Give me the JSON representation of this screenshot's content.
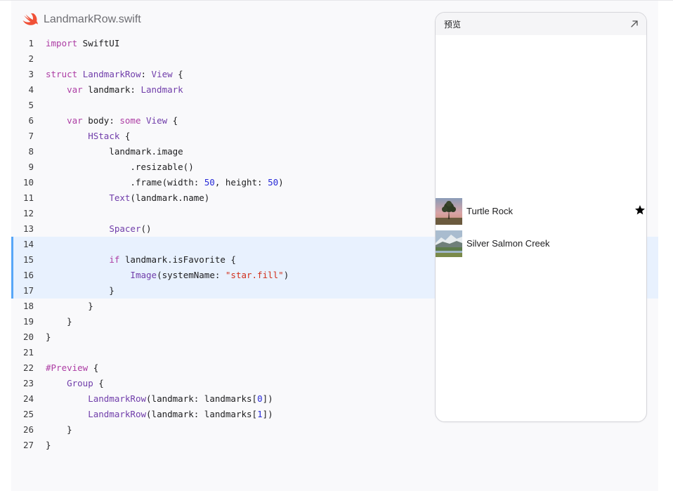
{
  "file": {
    "name": "LandmarkRow.swift",
    "icon": "swift-logo-icon"
  },
  "code_lines": [
    {
      "n": "1",
      "html": "<span class=\"kw\">import</span> SwiftUI"
    },
    {
      "n": "2",
      "html": ""
    },
    {
      "n": "3",
      "html": "<span class=\"kw\">struct</span> <span class=\"ty\">LandmarkRow</span>: <span class=\"ty\">View</span> {"
    },
    {
      "n": "4",
      "html": "    <span class=\"kw\">var</span> landmark: <span class=\"ty\">Landmark</span>"
    },
    {
      "n": "5",
      "html": ""
    },
    {
      "n": "6",
      "html": "    <span class=\"kw\">var</span> body: <span class=\"kw\">some</span> <span class=\"ty\">View</span> {"
    },
    {
      "n": "7",
      "html": "        <span class=\"ty\">HStack</span> {"
    },
    {
      "n": "8",
      "html": "            landmark.image"
    },
    {
      "n": "9",
      "html": "                .resizable()"
    },
    {
      "n": "10",
      "html": "                .frame(width: <span class=\"num\">50</span>, height: <span class=\"num\">50</span>)"
    },
    {
      "n": "11",
      "html": "            <span class=\"ty\">Text</span>(landmark.name)"
    },
    {
      "n": "12",
      "html": ""
    },
    {
      "n": "13",
      "html": "            <span class=\"ty\">Spacer</span>()"
    },
    {
      "n": "14",
      "html": ""
    },
    {
      "n": "15",
      "html": "            <span class=\"kw\">if</span> landmark.isFavorite {"
    },
    {
      "n": "16",
      "html": "                <span class=\"ty\">Image</span>(systemName: <span class=\"str\">\"star.fill\"</span>)"
    },
    {
      "n": "17",
      "html": "            }"
    },
    {
      "n": "18",
      "html": "        }"
    },
    {
      "n": "19",
      "html": "    }"
    },
    {
      "n": "20",
      "html": "}"
    },
    {
      "n": "21",
      "html": ""
    },
    {
      "n": "22",
      "html": "<span class=\"kw\">#Preview</span> {"
    },
    {
      "n": "23",
      "html": "    <span class=\"ty\">Group</span> {"
    },
    {
      "n": "24",
      "html": "        <span class=\"ty\">LandmarkRow</span>(landmark: landmarks[<span class=\"num\">0</span>])"
    },
    {
      "n": "25",
      "html": "        <span class=\"ty\">LandmarkRow</span>(landmark: landmarks[<span class=\"num\">1</span>])"
    },
    {
      "n": "26",
      "html": "    }"
    },
    {
      "n": "27",
      "html": "}"
    }
  ],
  "highlighted_lines": [
    "14",
    "15",
    "16",
    "17"
  ],
  "preview": {
    "title": "预览",
    "expand_icon": "expand-arrow-icon",
    "rows": [
      {
        "name": "Turtle Rock",
        "favorite": true,
        "thumb": "turtle-rock-thumbnail"
      },
      {
        "name": "Silver Salmon Creek",
        "favorite": false,
        "thumb": "silver-salmon-creek-thumbnail"
      }
    ]
  },
  "colors": {
    "keyword": "#ad3da4",
    "type": "#703daa",
    "number": "#272ad8",
    "string": "#d12f1b",
    "highlight": "#e8f1fe",
    "highlight_bar": "#57a6f8",
    "swift_orange": "#f05138"
  }
}
